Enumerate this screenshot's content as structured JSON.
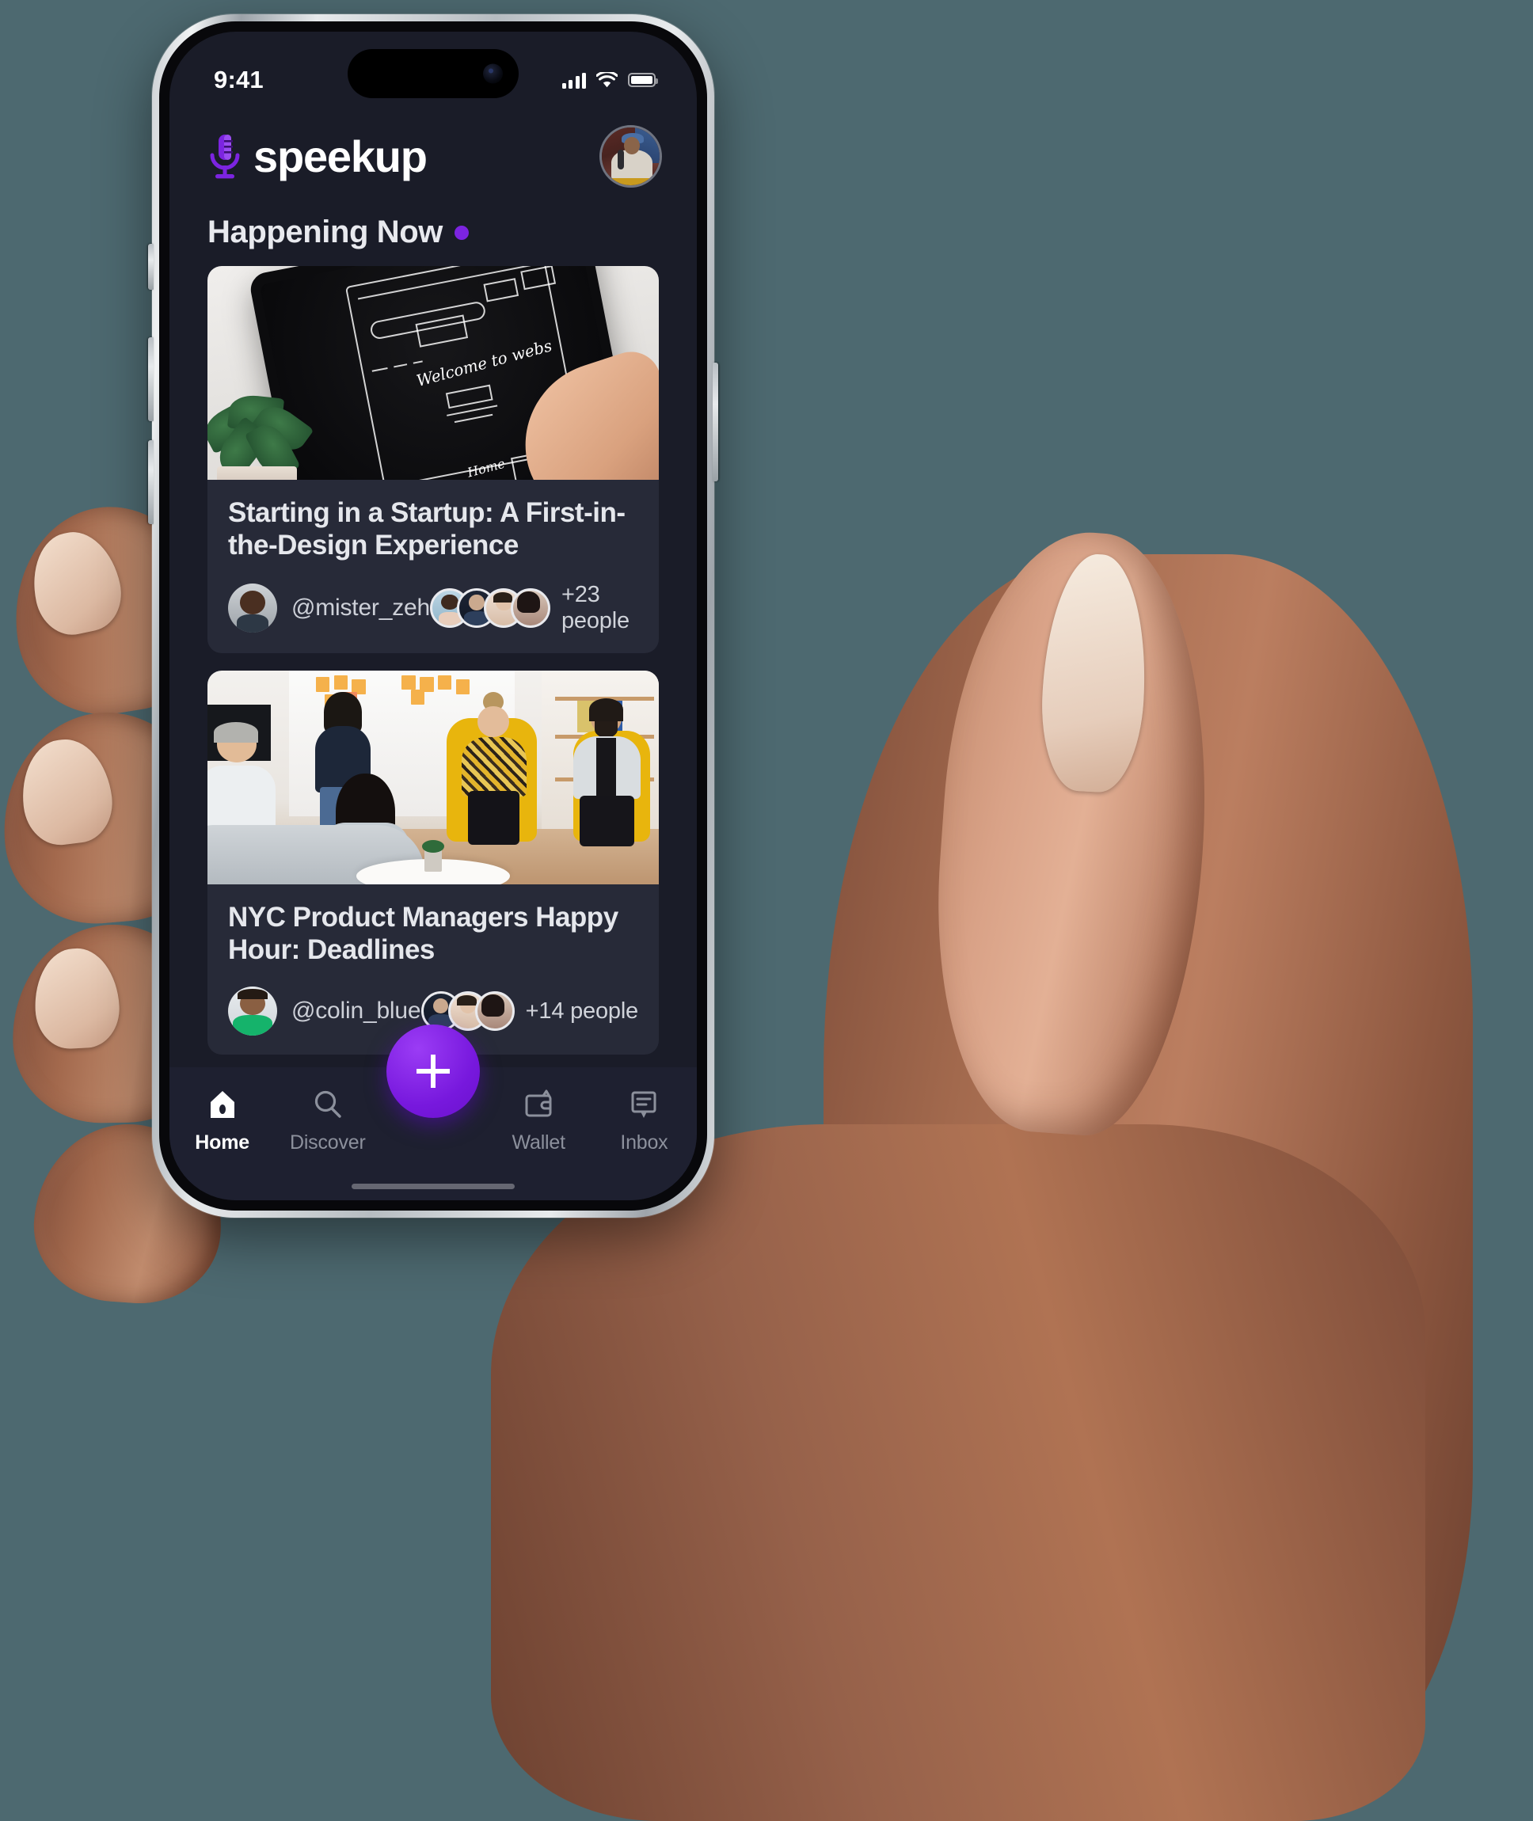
{
  "background_color": "#4d6970",
  "status_bar": {
    "time": "9:41",
    "signal_icon": "cellular-bars-icon",
    "wifi_icon": "wifi-icon",
    "battery_icon": "battery-full-icon"
  },
  "app_header": {
    "brand_name": "speekup",
    "brand_icon": "microphone-icon",
    "brand_color": "#7c24e0",
    "profile_avatar": "user-avatar"
  },
  "section": {
    "title": "Happening Now",
    "live_dot_color": "#7c24e0"
  },
  "cards": [
    {
      "title": "Starting in a Startup: A First-in-the-Design Experience",
      "host": "@mister_zeh",
      "host_avatar": "host-avatar",
      "attendee_count_label": "+23 people",
      "attendee_avatars": [
        "attendee-avatar-1",
        "attendee-avatar-2",
        "attendee-avatar-3",
        "attendee-avatar-4"
      ],
      "media": "tablet-wireframe-photo"
    },
    {
      "title": "NYC Product Managers Happy Hour: Deadlines",
      "host": "@colin_blue",
      "host_avatar": "host-avatar",
      "attendee_count_label": "+14 people",
      "attendee_avatars": [
        "attendee-avatar-1",
        "attendee-avatar-2",
        "attendee-avatar-3"
      ],
      "media": "office-meeting-photo"
    },
    {
      "title": "",
      "host": "",
      "host_avatar": "",
      "attendee_count_label": "",
      "attendee_avatars": [],
      "media": "three-women-hex-wall-photo"
    }
  ],
  "fab": {
    "label": "+",
    "icon": "plus-icon",
    "color": "#7718dd"
  },
  "bottom_nav": {
    "items": [
      {
        "label": "Home",
        "icon": "home-icon",
        "active": true
      },
      {
        "label": "Discover",
        "icon": "search-icon",
        "active": false
      },
      {
        "label": "Wallet",
        "icon": "wallet-icon",
        "active": false
      },
      {
        "label": "Inbox",
        "icon": "chat-icon",
        "active": false
      }
    ]
  }
}
